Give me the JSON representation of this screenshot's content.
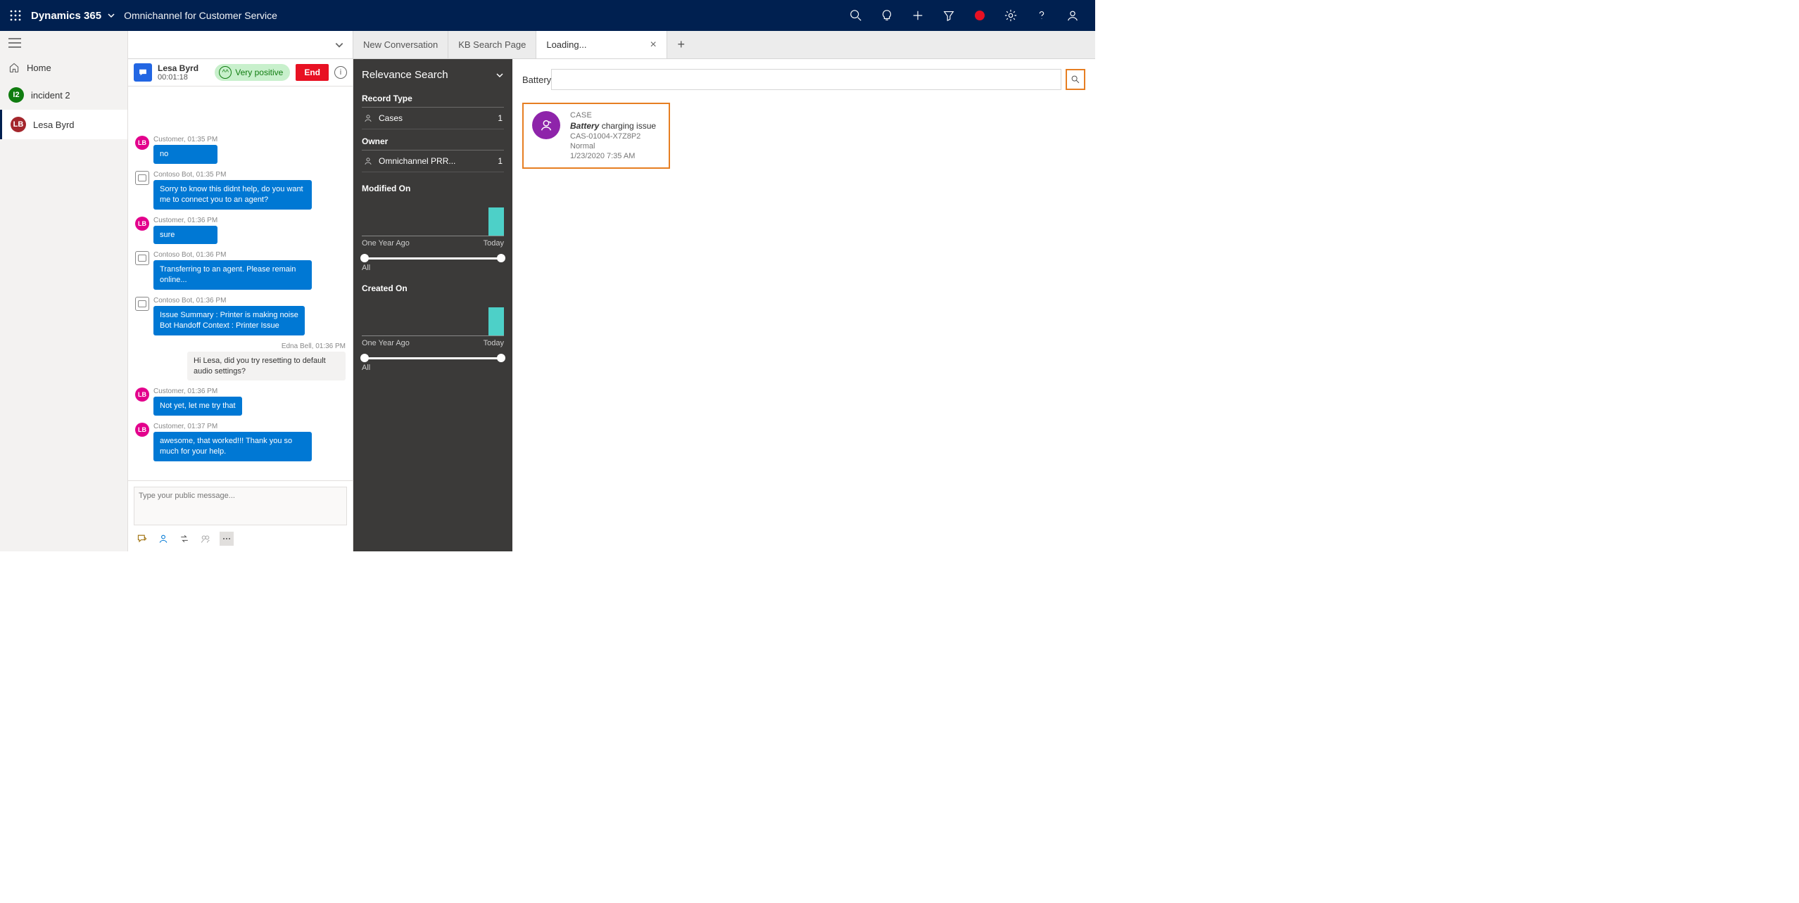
{
  "topbar": {
    "app": "Dynamics 365",
    "subtitle": "Omnichannel for Customer Service"
  },
  "sidebar": {
    "home": "Home",
    "items": [
      {
        "badge": "I2",
        "label": "incident 2",
        "badge_color": "green"
      },
      {
        "badge": "LB",
        "label": "Lesa Byrd",
        "badge_color": "red"
      }
    ]
  },
  "tabs": {
    "t0": "New Conversation",
    "t1": "KB Search Page",
    "t2": "Loading..."
  },
  "convo": {
    "name": "Lesa Byrd",
    "timer": "00:01:18",
    "sentiment": "Very positive",
    "end": "End",
    "compose_placeholder": "Type your public message...",
    "messages": [
      {
        "who": "cust",
        "meta": "Customer, 01:35 PM",
        "text": "no"
      },
      {
        "who": "bot",
        "meta": "Contoso Bot, 01:35 PM",
        "text": "Sorry to know this didnt help, do you want me to connect you to an agent?"
      },
      {
        "who": "cust",
        "meta": "Customer, 01:36 PM",
        "text": "sure"
      },
      {
        "who": "bot",
        "meta": "Contoso Bot, 01:36 PM",
        "text": "Transferring to an agent. Please remain online..."
      },
      {
        "who": "bot",
        "meta": "Contoso Bot, 01:36 PM",
        "text": "Issue Summary : Printer is making noise\nBot Handoff Context : Printer Issue"
      },
      {
        "who": "agent",
        "meta": "Edna Bell,  01:36 PM",
        "text": "Hi Lesa, did you try resetting to default audio settings?"
      },
      {
        "who": "cust",
        "meta": "Customer, 01:36 PM",
        "text": "Not yet, let me try that"
      },
      {
        "who": "cust",
        "meta": "Customer, 01:37 PM",
        "text": "awesome, that worked!!! Thank you so much for your help."
      }
    ]
  },
  "relevance": {
    "title": "Relevance Search",
    "record_type": "Record Type",
    "cases": "Cases",
    "cases_count": "1",
    "owner": "Owner",
    "owner_name": "Omnichannel PRR...",
    "owner_count": "1",
    "modified_on": "Modified On",
    "created_on": "Created On",
    "axis_left": "One Year Ago",
    "axis_right": "Today",
    "all": "All"
  },
  "search": {
    "query": "Battery"
  },
  "result": {
    "type": "CASE",
    "title_bold": "Battery",
    "title_rest": " charging issue",
    "case_num": "CAS-01004-X7Z8P2",
    "priority": "Normal",
    "date": "1/23/2020 7:35 AM"
  },
  "chart_data": [
    {
      "type": "bar",
      "title": "Modified On",
      "categories": [
        "One Year Ago",
        "",
        "",
        "",
        "",
        "Today"
      ],
      "values": [
        0,
        0,
        0,
        0,
        0,
        1
      ],
      "xlabel": "",
      "ylabel": "",
      "ylim": [
        0,
        1
      ]
    },
    {
      "type": "bar",
      "title": "Created On",
      "categories": [
        "One Year Ago",
        "",
        "",
        "",
        "",
        "Today"
      ],
      "values": [
        0,
        0,
        0,
        0,
        0,
        1
      ],
      "xlabel": "",
      "ylabel": "",
      "ylim": [
        0,
        1
      ]
    }
  ]
}
